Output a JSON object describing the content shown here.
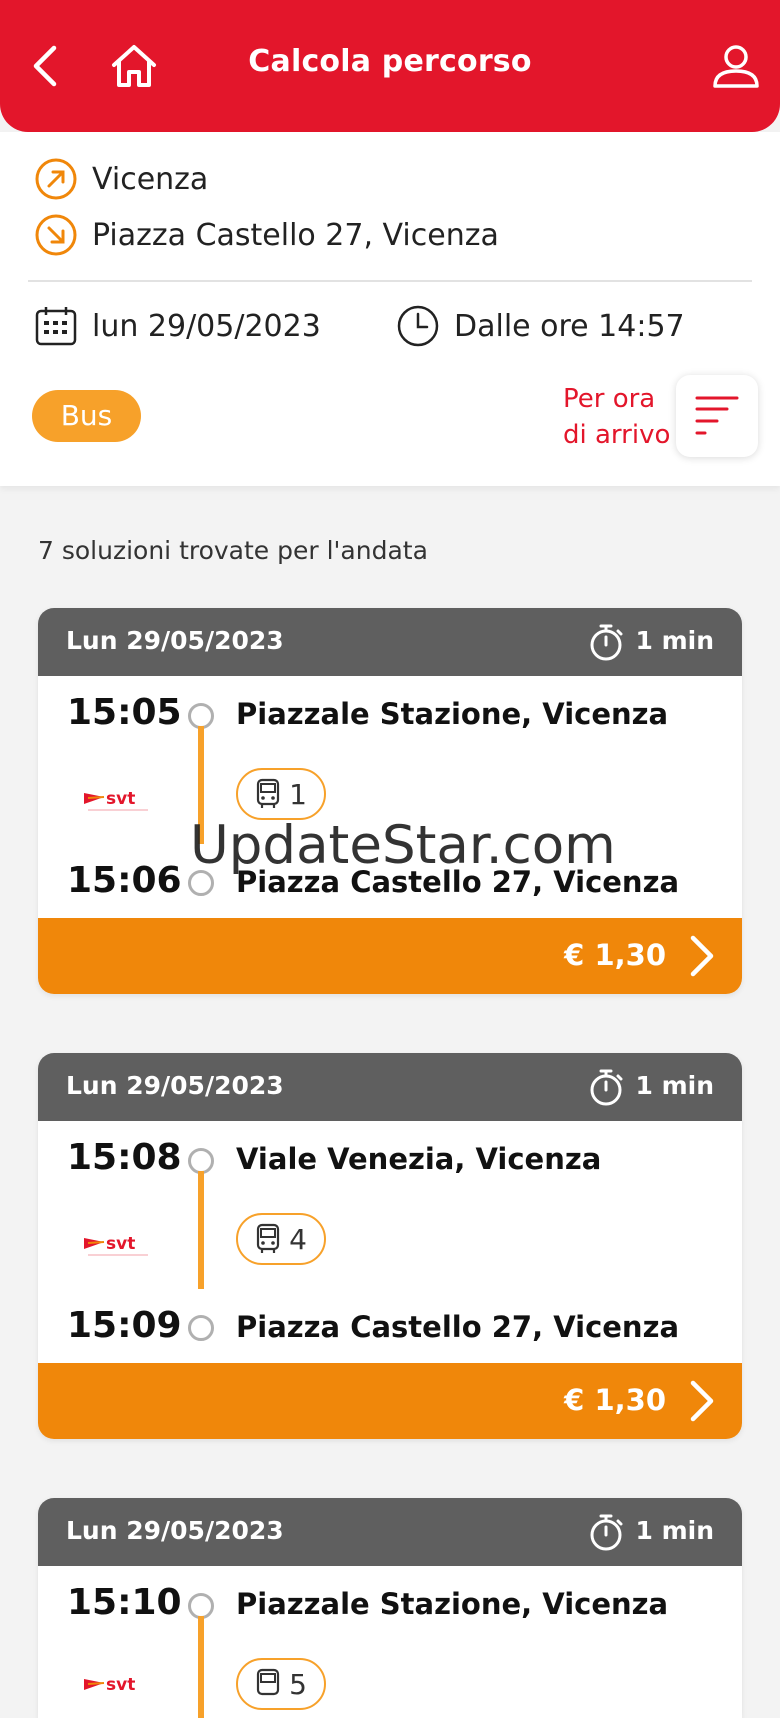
{
  "header": {
    "title": "Calcola percorso"
  },
  "search": {
    "origin": "Vicenza",
    "destination": "Piazza Castello 27, Vicenza",
    "date": "lun 29/05/2023",
    "time": "Dalle ore 14:57",
    "mode_chip": "Bus",
    "sort_label_line1": "Per ora",
    "sort_label_line2": "di arrivo"
  },
  "results_count": "7 soluzioni trovate per l'andata",
  "cards": [
    {
      "date": "Lun 29/05/2023",
      "duration": "1 min",
      "dep_time": "15:05",
      "dep_stop": "Piazzale Stazione, Vicenza",
      "line": "1",
      "arr_time": "15:06",
      "arr_stop": "Piazza Castello 27, Vicenza",
      "price": "€ 1,30",
      "operator": "svt"
    },
    {
      "date": "Lun 29/05/2023",
      "duration": "1 min",
      "dep_time": "15:08",
      "dep_stop": "Viale Venezia, Vicenza",
      "line": "4",
      "arr_time": "15:09",
      "arr_stop": "Piazza Castello 27, Vicenza",
      "price": "€ 1,30",
      "operator": "svt"
    },
    {
      "date": "Lun 29/05/2023",
      "duration": "1 min",
      "dep_time": "15:10",
      "dep_stop": "Piazzale Stazione, Vicenza",
      "line": "5",
      "operator": "svt"
    }
  ],
  "watermark": "UpdateStar.com",
  "colors": {
    "brand_red": "#e3162b",
    "orange": "#f0870a",
    "line_orange": "#f7a12a",
    "card_header": "#5f5f5f"
  }
}
